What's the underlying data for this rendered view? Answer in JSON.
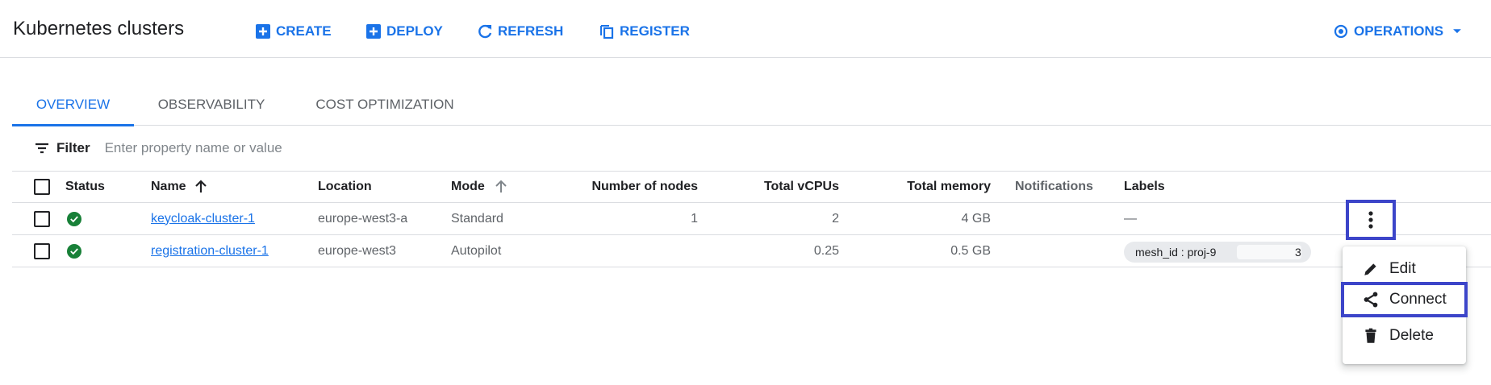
{
  "header": {
    "title": "Kubernetes clusters",
    "create_label": "CREATE",
    "deploy_label": "DEPLOY",
    "refresh_label": "REFRESH",
    "register_label": "REGISTER",
    "operations_label": "OPERATIONS"
  },
  "tabs": [
    {
      "label": "OVERVIEW",
      "active": true
    },
    {
      "label": "OBSERVABILITY",
      "active": false
    },
    {
      "label": "COST OPTIMIZATION",
      "active": false
    }
  ],
  "filter": {
    "label": "Filter",
    "placeholder": "Enter property name or value"
  },
  "table": {
    "columns": {
      "status": "Status",
      "name": "Name",
      "location": "Location",
      "mode": "Mode",
      "nodes": "Number of nodes",
      "vcpus": "Total vCPUs",
      "memory": "Total memory",
      "notifications": "Notifications",
      "labels": "Labels"
    },
    "rows": [
      {
        "name": "keycloak-cluster-1",
        "location": "europe-west3-a",
        "mode": "Standard",
        "nodes": "1",
        "vcpus": "2",
        "memory": "4 GB",
        "notifications": "",
        "labels": "—"
      },
      {
        "name": "registration-cluster-1",
        "location": "europe-west3",
        "mode": "Autopilot",
        "nodes": "",
        "vcpus": "0.25",
        "memory": "0.5 GB",
        "notifications": "",
        "labels": "mesh_id : proj-9",
        "labels_suffix": "3"
      }
    ]
  },
  "menu": {
    "items": [
      {
        "label": "Edit",
        "icon": "pencil-icon"
      },
      {
        "label": "Connect",
        "icon": "share-icon"
      },
      {
        "label": "Delete",
        "icon": "trash-icon"
      }
    ]
  },
  "colors": {
    "accent": "#1a73e8",
    "success": "#188038",
    "highlight_box": "#3c45c9"
  }
}
